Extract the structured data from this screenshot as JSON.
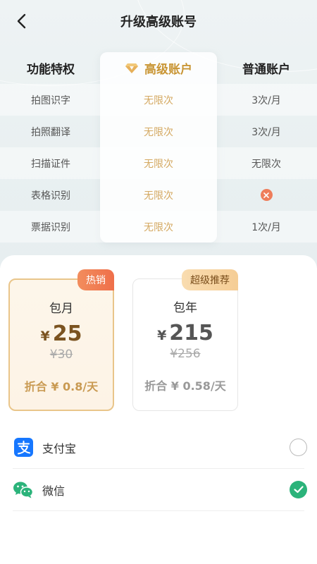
{
  "header": {
    "title": "升级高级账号"
  },
  "table": {
    "headers": {
      "feature": "功能特权",
      "premium": "高级账户",
      "basic": "普通账户"
    },
    "rows": [
      {
        "feature": "拍图识字",
        "premium": "无限次",
        "basic": "3次/月"
      },
      {
        "feature": "拍照翻译",
        "premium": "无限次",
        "basic": "3次/月"
      },
      {
        "feature": "扫描证件",
        "premium": "无限次",
        "basic": "无限次"
      },
      {
        "feature": "表格识别",
        "premium": "无限次",
        "basic": ""
      },
      {
        "feature": "票据识别",
        "premium": "无限次",
        "basic": "1次/月"
      }
    ]
  },
  "plans": {
    "monthly": {
      "tag": "热销",
      "name": "包月",
      "currency": "¥",
      "price": "25",
      "original": "¥30",
      "daily": "折合 ¥ 0.8/天"
    },
    "yearly": {
      "tag": "超级推荐",
      "name": "包年",
      "currency": "¥",
      "price": "215",
      "original": "¥256",
      "daily": "折合 ¥ 0.58/天"
    }
  },
  "payments": {
    "alipay": {
      "label": "支付宝",
      "selected": false
    },
    "wechat": {
      "label": "微信",
      "selected": true
    }
  },
  "colors": {
    "gold": "#c99636",
    "accent_orange": "#ef6f4a",
    "wechat_green": "#2bb37a",
    "alipay_blue": "#1677ff"
  }
}
